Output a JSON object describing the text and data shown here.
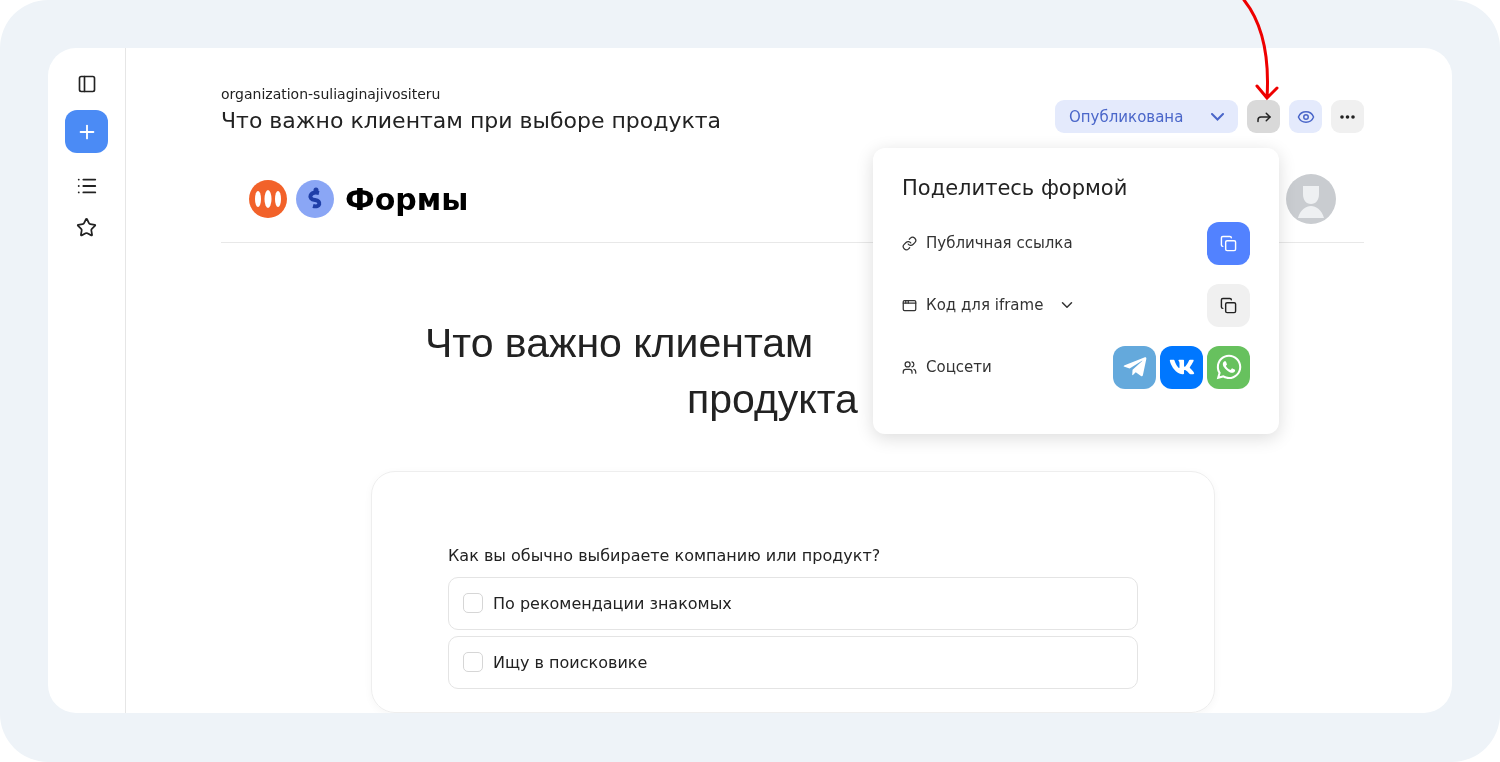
{
  "header": {
    "organization": "organization-suliaginajivositeru",
    "title": "Что важно клиентам при выборе продукта",
    "status": {
      "label": "Опубликована"
    }
  },
  "form_preview": {
    "brand": "Формы",
    "title_lines": [
      "Что важно клиентам",
      "продукта"
    ],
    "question": {
      "text": "Как вы обычно выбираете компанию или продукт?",
      "options": [
        {
          "label": "По рекомендации знакомых",
          "checked": false
        },
        {
          "label": "Ищу в поисковике",
          "checked": false
        }
      ]
    }
  },
  "share_popup": {
    "title": "Поделитесь формой",
    "rows": [
      {
        "kind": "link",
        "label": "Публичная ссылка",
        "primary": true
      },
      {
        "kind": "iframe",
        "label": "Код для iframe",
        "primary": false
      },
      {
        "kind": "social",
        "label": "Соцсети"
      }
    ]
  }
}
